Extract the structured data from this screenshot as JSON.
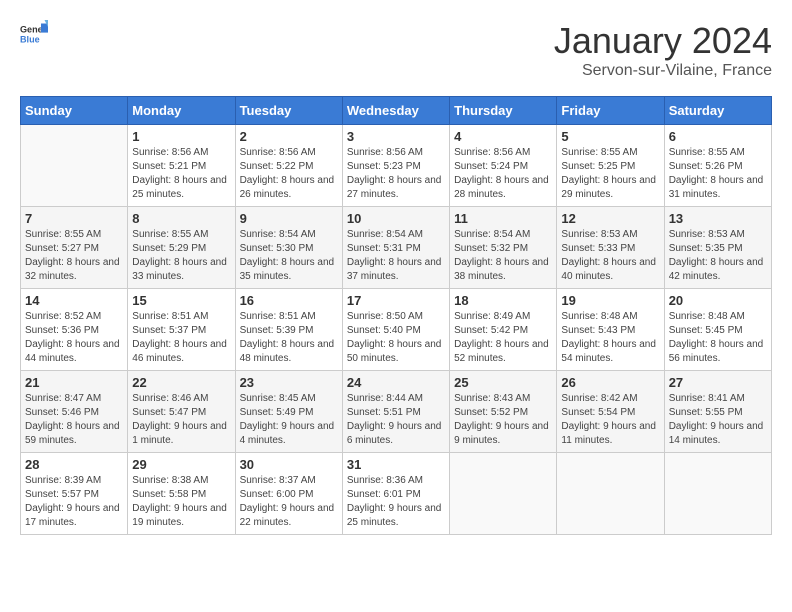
{
  "header": {
    "logo_general": "General",
    "logo_blue": "Blue",
    "month_title": "January 2024",
    "location": "Servon-sur-Vilaine, France"
  },
  "weekdays": [
    "Sunday",
    "Monday",
    "Tuesday",
    "Wednesday",
    "Thursday",
    "Friday",
    "Saturday"
  ],
  "weeks": [
    [
      {
        "day": "",
        "sunrise": "",
        "sunset": "",
        "daylight": ""
      },
      {
        "day": "1",
        "sunrise": "Sunrise: 8:56 AM",
        "sunset": "Sunset: 5:21 PM",
        "daylight": "Daylight: 8 hours and 25 minutes."
      },
      {
        "day": "2",
        "sunrise": "Sunrise: 8:56 AM",
        "sunset": "Sunset: 5:22 PM",
        "daylight": "Daylight: 8 hours and 26 minutes."
      },
      {
        "day": "3",
        "sunrise": "Sunrise: 8:56 AM",
        "sunset": "Sunset: 5:23 PM",
        "daylight": "Daylight: 8 hours and 27 minutes."
      },
      {
        "day": "4",
        "sunrise": "Sunrise: 8:56 AM",
        "sunset": "Sunset: 5:24 PM",
        "daylight": "Daylight: 8 hours and 28 minutes."
      },
      {
        "day": "5",
        "sunrise": "Sunrise: 8:55 AM",
        "sunset": "Sunset: 5:25 PM",
        "daylight": "Daylight: 8 hours and 29 minutes."
      },
      {
        "day": "6",
        "sunrise": "Sunrise: 8:55 AM",
        "sunset": "Sunset: 5:26 PM",
        "daylight": "Daylight: 8 hours and 31 minutes."
      }
    ],
    [
      {
        "day": "7",
        "sunrise": "Sunrise: 8:55 AM",
        "sunset": "Sunset: 5:27 PM",
        "daylight": "Daylight: 8 hours and 32 minutes."
      },
      {
        "day": "8",
        "sunrise": "Sunrise: 8:55 AM",
        "sunset": "Sunset: 5:29 PM",
        "daylight": "Daylight: 8 hours and 33 minutes."
      },
      {
        "day": "9",
        "sunrise": "Sunrise: 8:54 AM",
        "sunset": "Sunset: 5:30 PM",
        "daylight": "Daylight: 8 hours and 35 minutes."
      },
      {
        "day": "10",
        "sunrise": "Sunrise: 8:54 AM",
        "sunset": "Sunset: 5:31 PM",
        "daylight": "Daylight: 8 hours and 37 minutes."
      },
      {
        "day": "11",
        "sunrise": "Sunrise: 8:54 AM",
        "sunset": "Sunset: 5:32 PM",
        "daylight": "Daylight: 8 hours and 38 minutes."
      },
      {
        "day": "12",
        "sunrise": "Sunrise: 8:53 AM",
        "sunset": "Sunset: 5:33 PM",
        "daylight": "Daylight: 8 hours and 40 minutes."
      },
      {
        "day": "13",
        "sunrise": "Sunrise: 8:53 AM",
        "sunset": "Sunset: 5:35 PM",
        "daylight": "Daylight: 8 hours and 42 minutes."
      }
    ],
    [
      {
        "day": "14",
        "sunrise": "Sunrise: 8:52 AM",
        "sunset": "Sunset: 5:36 PM",
        "daylight": "Daylight: 8 hours and 44 minutes."
      },
      {
        "day": "15",
        "sunrise": "Sunrise: 8:51 AM",
        "sunset": "Sunset: 5:37 PM",
        "daylight": "Daylight: 8 hours and 46 minutes."
      },
      {
        "day": "16",
        "sunrise": "Sunrise: 8:51 AM",
        "sunset": "Sunset: 5:39 PM",
        "daylight": "Daylight: 8 hours and 48 minutes."
      },
      {
        "day": "17",
        "sunrise": "Sunrise: 8:50 AM",
        "sunset": "Sunset: 5:40 PM",
        "daylight": "Daylight: 8 hours and 50 minutes."
      },
      {
        "day": "18",
        "sunrise": "Sunrise: 8:49 AM",
        "sunset": "Sunset: 5:42 PM",
        "daylight": "Daylight: 8 hours and 52 minutes."
      },
      {
        "day": "19",
        "sunrise": "Sunrise: 8:48 AM",
        "sunset": "Sunset: 5:43 PM",
        "daylight": "Daylight: 8 hours and 54 minutes."
      },
      {
        "day": "20",
        "sunrise": "Sunrise: 8:48 AM",
        "sunset": "Sunset: 5:45 PM",
        "daylight": "Daylight: 8 hours and 56 minutes."
      }
    ],
    [
      {
        "day": "21",
        "sunrise": "Sunrise: 8:47 AM",
        "sunset": "Sunset: 5:46 PM",
        "daylight": "Daylight: 8 hours and 59 minutes."
      },
      {
        "day": "22",
        "sunrise": "Sunrise: 8:46 AM",
        "sunset": "Sunset: 5:47 PM",
        "daylight": "Daylight: 9 hours and 1 minute."
      },
      {
        "day": "23",
        "sunrise": "Sunrise: 8:45 AM",
        "sunset": "Sunset: 5:49 PM",
        "daylight": "Daylight: 9 hours and 4 minutes."
      },
      {
        "day": "24",
        "sunrise": "Sunrise: 8:44 AM",
        "sunset": "Sunset: 5:51 PM",
        "daylight": "Daylight: 9 hours and 6 minutes."
      },
      {
        "day": "25",
        "sunrise": "Sunrise: 8:43 AM",
        "sunset": "Sunset: 5:52 PM",
        "daylight": "Daylight: 9 hours and 9 minutes."
      },
      {
        "day": "26",
        "sunrise": "Sunrise: 8:42 AM",
        "sunset": "Sunset: 5:54 PM",
        "daylight": "Daylight: 9 hours and 11 minutes."
      },
      {
        "day": "27",
        "sunrise": "Sunrise: 8:41 AM",
        "sunset": "Sunset: 5:55 PM",
        "daylight": "Daylight: 9 hours and 14 minutes."
      }
    ],
    [
      {
        "day": "28",
        "sunrise": "Sunrise: 8:39 AM",
        "sunset": "Sunset: 5:57 PM",
        "daylight": "Daylight: 9 hours and 17 minutes."
      },
      {
        "day": "29",
        "sunrise": "Sunrise: 8:38 AM",
        "sunset": "Sunset: 5:58 PM",
        "daylight": "Daylight: 9 hours and 19 minutes."
      },
      {
        "day": "30",
        "sunrise": "Sunrise: 8:37 AM",
        "sunset": "Sunset: 6:00 PM",
        "daylight": "Daylight: 9 hours and 22 minutes."
      },
      {
        "day": "31",
        "sunrise": "Sunrise: 8:36 AM",
        "sunset": "Sunset: 6:01 PM",
        "daylight": "Daylight: 9 hours and 25 minutes."
      },
      {
        "day": "",
        "sunrise": "",
        "sunset": "",
        "daylight": ""
      },
      {
        "day": "",
        "sunrise": "",
        "sunset": "",
        "daylight": ""
      },
      {
        "day": "",
        "sunrise": "",
        "sunset": "",
        "daylight": ""
      }
    ]
  ]
}
